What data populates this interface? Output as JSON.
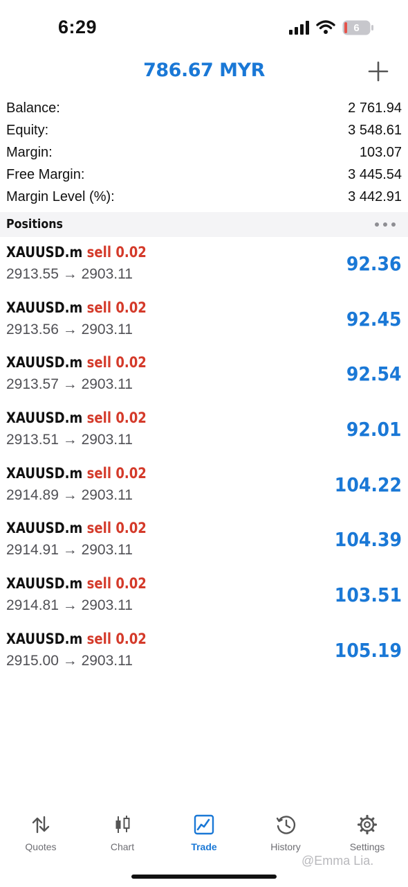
{
  "status_bar": {
    "time": "6:29",
    "battery_level": "6"
  },
  "header": {
    "title": "786.67 MYR"
  },
  "summary": [
    {
      "label": "Balance:",
      "value": "2 761.94"
    },
    {
      "label": "Equity:",
      "value": "3 548.61"
    },
    {
      "label": "Margin:",
      "value": "103.07"
    },
    {
      "label": "Free Margin:",
      "value": "3 445.54"
    },
    {
      "label": "Margin Level (%):",
      "value": "3 442.91"
    }
  ],
  "positions_section": {
    "title": "Positions"
  },
  "positions": [
    {
      "symbol": "XAUUSD.m",
      "side": "sell 0.02",
      "prices": "2913.55 → 2903.11",
      "profit": "92.36"
    },
    {
      "symbol": "XAUUSD.m",
      "side": "sell 0.02",
      "prices": "2913.56 → 2903.11",
      "profit": "92.45"
    },
    {
      "symbol": "XAUUSD.m",
      "side": "sell 0.02",
      "prices": "2913.57 → 2903.11",
      "profit": "92.54"
    },
    {
      "symbol": "XAUUSD.m",
      "side": "sell 0.02",
      "prices": "2913.51 → 2903.11",
      "profit": "92.01"
    },
    {
      "symbol": "XAUUSD.m",
      "side": "sell 0.02",
      "prices": "2914.89 → 2903.11",
      "profit": "104.22"
    },
    {
      "symbol": "XAUUSD.m",
      "side": "sell 0.02",
      "prices": "2914.91 → 2903.11",
      "profit": "104.39"
    },
    {
      "symbol": "XAUUSD.m",
      "side": "sell 0.02",
      "prices": "2914.81 → 2903.11",
      "profit": "103.51"
    },
    {
      "symbol": "XAUUSD.m",
      "side": "sell 0.02",
      "prices": "2915.00 → 2903.11",
      "profit": "105.19"
    }
  ],
  "tabs": [
    {
      "label": "Quotes",
      "icon": "quotes-arrows-icon",
      "active": false
    },
    {
      "label": "Chart",
      "icon": "candlestick-chart-icon",
      "active": false
    },
    {
      "label": "Trade",
      "icon": "trade-chart-icon",
      "active": true
    },
    {
      "label": "History",
      "icon": "history-clock-icon",
      "active": false
    },
    {
      "label": "Settings",
      "icon": "gear-icon",
      "active": false
    }
  ],
  "watermark": "@Emma Lia.",
  "colors": {
    "accent": "#1a78d6",
    "sell": "#d43a2a",
    "section_bg": "#f4f4f6",
    "battery_low": "#e5534b"
  }
}
